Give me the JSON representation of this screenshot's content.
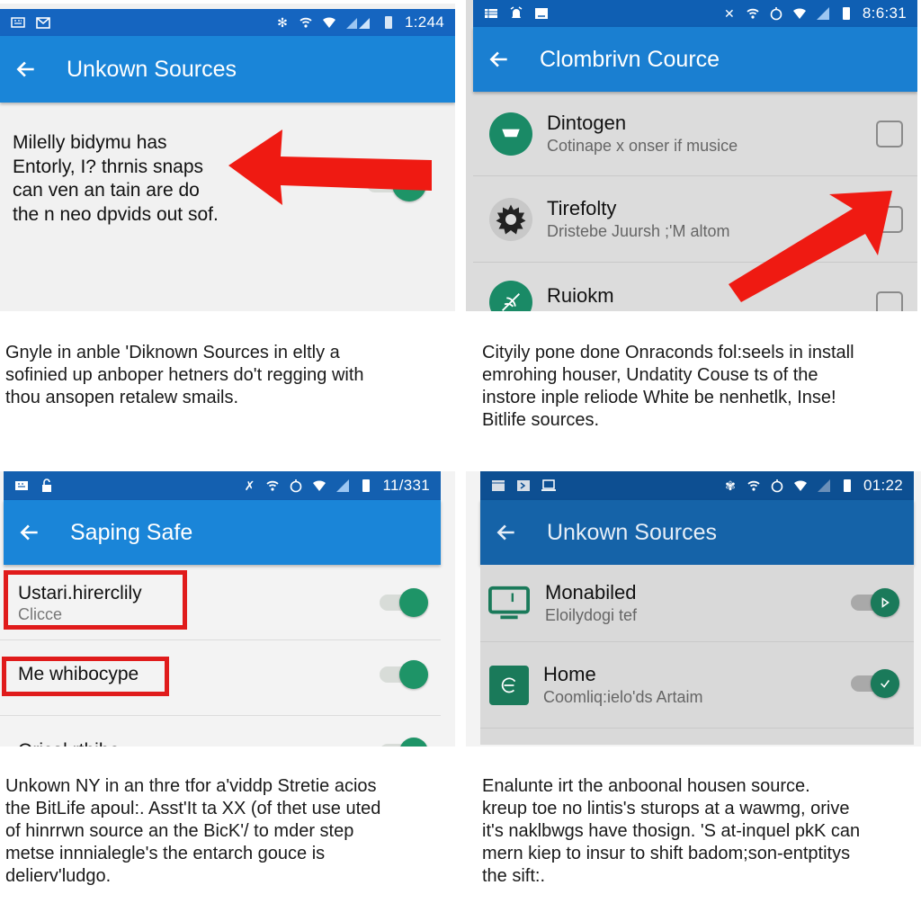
{
  "colors": {
    "statusbar_blue": "#1565c0",
    "appbar_blue": "#1a85d8",
    "statusbar_dark": "#0d4f92",
    "appbar_dark": "#1563a8",
    "accent_green": "#1e9467",
    "annotation_red": "#ef1a12"
  },
  "panels": [
    {
      "status": {
        "left_icons": [
          "keyboard-icon",
          "gmail-icon"
        ],
        "right_icons": [
          "bluetooth-icon",
          "wifi-icon",
          "wifi-signal-icon",
          "cell-signal-icon",
          "battery-icon"
        ],
        "time": "1:244"
      },
      "appbar": {
        "back_icon": "arrow-left-icon",
        "title": "Unkown Sources"
      },
      "body_text": [
        "Milelly bidymu has",
        "Entorly, I? thrnis snaps",
        "can ven an tain are do",
        "the n neo dpvids out sof."
      ],
      "toggle": {
        "state": "on"
      },
      "annotation": "red-arrow-pointing-left",
      "caption": [
        "Gnyle in anble 'Diknown Sources in eltly a",
        "sofinied up anboper hetners do't regging with",
        "thou ansopen retalew smails."
      ]
    },
    {
      "status": {
        "left_icons": [
          "list-icon",
          "alarm-icon",
          "image-icon"
        ],
        "right_icons": [
          "bluetooth-icon",
          "wifi-icon",
          "timer-icon",
          "wifi-signal-icon",
          "cell-signal-icon",
          "battery-icon"
        ],
        "time": "8:6:31"
      },
      "appbar": {
        "back_icon": "arrow-left-icon",
        "title": "Clombrivn Cource"
      },
      "rows": [
        {
          "icon": "bowl-icon",
          "title": "Dintogen",
          "subtitle": "Cotinape x onser if musice",
          "checked": false
        },
        {
          "icon": "gear-badge-icon",
          "title": "Tirefolty",
          "subtitle": "Dristebe Juursh ;'M altom",
          "checked": false
        },
        {
          "icon": "leaf-icon",
          "title": "Ruiokm",
          "subtitle": "",
          "checked": false
        }
      ],
      "annotation": "red-arrow-pointing-up-right",
      "caption": [
        "Cityily pone done Onraconds fol:seels in install",
        "emrohing houser, Undatity Couse ts of the",
        "instore inple reliode White be nenhetlk, Inse!",
        "Bitlife sources."
      ]
    },
    {
      "status": {
        "left_icons": [
          "keyboard-icon",
          "lock-icon"
        ],
        "right_icons": [
          "bluetooth-icon",
          "wifi-icon",
          "timer-icon",
          "wifi-signal-icon",
          "cell-signal-icon",
          "battery-icon"
        ],
        "time": "11/331"
      },
      "appbar": {
        "back_icon": "arrow-left-icon",
        "title": "Saping Safe"
      },
      "rows": [
        {
          "title": "Ustari.hirerclily",
          "subtitle": "Clicce",
          "toggle": "on",
          "highlighted": true
        },
        {
          "title": "Me whibocype",
          "subtitle": "",
          "toggle": "on",
          "highlighted": true
        },
        {
          "title": "Orical rthibe",
          "subtitle": "",
          "toggle": "on",
          "highlighted": false
        }
      ],
      "caption": [
        "Unkown NY in an thre tfor a'viddp Stretie acios",
        "the BitLife apoul:. Asst'It ta XX (of thet use uted",
        "of hinrrwn source an the BicK'/ to mder step",
        "metse innnialegle's the entarch gouce is",
        "delierv'ludgo."
      ]
    },
    {
      "status": {
        "left_icons": [
          "window-icon",
          "terminal-icon",
          "laptop-icon"
        ],
        "right_icons": [
          "bluetooth-icon",
          "wifi-icon",
          "timer-icon",
          "wifi-signal-icon",
          "cell-signal-icon",
          "battery-icon"
        ],
        "time": "01:22"
      },
      "appbar": {
        "back_icon": "arrow-left-icon",
        "title": "Unkown Sources"
      },
      "rows": [
        {
          "icon": "monitor-icon",
          "title": "Monabiled",
          "subtitle": "Eloilydogi tef",
          "toggle": "on"
        },
        {
          "icon": "home-app-icon",
          "title": "Home",
          "subtitle": "Coomliq:ielo'ds Artaim",
          "toggle": "on"
        }
      ],
      "caption": [
        "Enalunte irt the anboonal housen source.",
        "kreup toe no lintis's sturops at a wawmg, orive",
        "it's naklbwgs have thosign. 'S at-inquel pkK can",
        "mern kiep to insur to shift badom;son-entptitys",
        "the sift:."
      ]
    }
  ]
}
